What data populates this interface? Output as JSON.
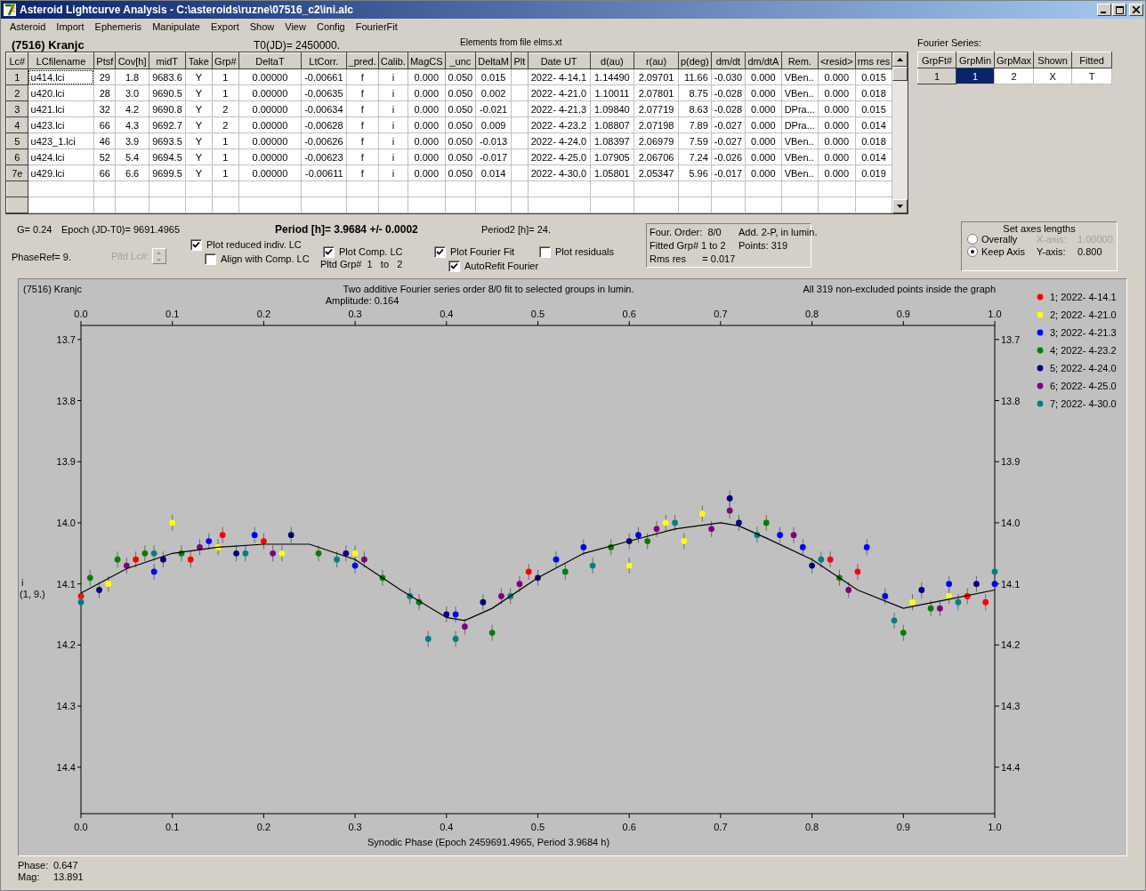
{
  "window": {
    "title": "Asteroid Lightcurve Analysis - C:\\asteroids\\ruzne\\07516_c2\\ini.alc"
  },
  "menu": [
    "Asteroid",
    "Import",
    "Ephemeris",
    "Manipulate",
    "Export",
    "Show",
    "View",
    "Config",
    "FourierFit"
  ],
  "header": {
    "object": "(7516) Kranjc",
    "t0": "T0(JD)= 2450000.",
    "elements_note": "Elements from file elms.xt"
  },
  "lc_table": {
    "columns": [
      "Lc#",
      "LCfilename",
      "Ptsf",
      "Cov[h]",
      "midT",
      "Take",
      "Grp#",
      "DeltaT",
      "LtCorr.",
      "_pred.",
      "Calib.",
      "MagCS",
      "_unc",
      "DeltaM",
      "Plt",
      "Date UT",
      "d(au)",
      "r(au)",
      "p(deg)",
      "dm/dt",
      "dm/dtA",
      "Rem.",
      "<resid>",
      "rms res"
    ],
    "rows": [
      {
        "focused": true,
        "cells": [
          "1",
          "u414.lci",
          "29",
          "1.8",
          "9683.6",
          "Y",
          "1",
          "0.00000",
          "-0.00661",
          "f",
          "i",
          "0.000",
          "0.050",
          "0.015",
          "",
          "2022- 4-14.1",
          "1.14490",
          "2.09701",
          "11.66",
          "-0.030",
          "0.000",
          "VBen..",
          "0.000",
          "0.015"
        ]
      },
      {
        "focused": false,
        "cells": [
          "2",
          "u420.lci",
          "28",
          "3.0",
          "9690.5",
          "Y",
          "1",
          "0.00000",
          "-0.00635",
          "f",
          "i",
          "0.000",
          "0.050",
          "0.002",
          "",
          "2022- 4-21.0",
          "1.10011",
          "2.07801",
          "8.75",
          "-0.028",
          "0.000",
          "VBen..",
          "0.000",
          "0.018"
        ]
      },
      {
        "focused": false,
        "cells": [
          "3",
          "u421.lci",
          "32",
          "4.2",
          "9690.8",
          "Y",
          "2",
          "0.00000",
          "-0.00634",
          "f",
          "i",
          "0.000",
          "0.050",
          "-0.021",
          "",
          "2022- 4-21.3",
          "1.09840",
          "2.07719",
          "8.63",
          "-0.028",
          "0.000",
          "DPra...",
          "0.000",
          "0.015"
        ]
      },
      {
        "focused": false,
        "cells": [
          "4",
          "u423.lci",
          "66",
          "4.3",
          "9692.7",
          "Y",
          "2",
          "0.00000",
          "-0.00628",
          "f",
          "i",
          "0.000",
          "0.050",
          "0.009",
          "",
          "2022- 4-23.2",
          "1.08807",
          "2.07198",
          "7.89",
          "-0.027",
          "0.000",
          "DPra...",
          "0.000",
          "0.014"
        ]
      },
      {
        "focused": false,
        "cells": [
          "5",
          "u423_1.lci",
          "46",
          "3.9",
          "9693.5",
          "Y",
          "1",
          "0.00000",
          "-0.00626",
          "f",
          "i",
          "0.000",
          "0.050",
          "-0.013",
          "",
          "2022- 4-24.0",
          "1.08397",
          "2.06979",
          "7.59",
          "-0.027",
          "0.000",
          "VBen..",
          "0.000",
          "0.018"
        ]
      },
      {
        "focused": false,
        "cells": [
          "6",
          "u424.lci",
          "52",
          "5.4",
          "9694.5",
          "Y",
          "1",
          "0.00000",
          "-0.00623",
          "f",
          "i",
          "0.000",
          "0.050",
          "-0.017",
          "",
          "2022- 4-25.0",
          "1.07905",
          "2.06706",
          "7.24",
          "-0.026",
          "0.000",
          "VBen..",
          "0.000",
          "0.014"
        ]
      },
      {
        "focused": false,
        "cells": [
          "7e",
          "u429.lci",
          "66",
          "6.6",
          "9699.5",
          "Y",
          "1",
          "0.00000",
          "-0.00611",
          "f",
          "i",
          "0.000",
          "0.050",
          "0.014",
          "",
          "2022- 4-30.0",
          "1.05801",
          "2.05347",
          "5.96",
          "-0.017",
          "0.000",
          "VBen..",
          "0.000",
          "0.019"
        ]
      }
    ]
  },
  "fourier_series": {
    "label": "Fourier Series:",
    "columns": [
      "GrpFt#",
      "GrpMin",
      "GrpMax",
      "Shown",
      "Fitted"
    ],
    "rows": [
      {
        "cells": [
          {
            "text": "1",
            "selected": false
          },
          {
            "text": "1",
            "selected": true
          },
          {
            "text": "2",
            "selected": false
          },
          {
            "text": "X",
            "selected": false
          },
          {
            "text": "T",
            "selected": false
          }
        ]
      }
    ]
  },
  "info": {
    "g": "G= 0.24",
    "epoch": "Epoch (JD-T0)= 9691.4965",
    "period": "Period [h]= 3.9684 +/- 0.0002",
    "period2": "Period2 [h]= 24.",
    "phase_ref": "PhaseRef= 9."
  },
  "pltd_lc": {
    "label": "Pltd Lc#:",
    "disabled": true
  },
  "checkboxes": [
    {
      "label": "Plot reduced indiv. LC",
      "checked": true
    },
    {
      "label": "Align with Comp. LC",
      "checked": false
    },
    {
      "label": "Plot Comp. LC",
      "checked": true
    },
    {
      "label": "Plot Fourier Fit",
      "checked": true
    },
    {
      "label": "AutoRefit Fourier",
      "checked": true
    },
    {
      "label": "Plot residuals",
      "checked": false
    }
  ],
  "pltd_grp": {
    "label": "Pltd Grp#",
    "from": "1",
    "to_label": "to",
    "to": "2"
  },
  "fit_summary": [
    "Four. Order:  8/0",
    "Add. 2-P, in lumin.",
    "Fitted Grp# 1 to 2",
    "Points: 319",
    "Rms res      = 0.017"
  ],
  "axes_lengths": {
    "title": "Set axes lengths",
    "radios": [
      {
        "label": "Overally",
        "selected": false
      },
      {
        "label": "Keep Axis",
        "selected": true
      }
    ],
    "fields": [
      {
        "label": "X-axis:",
        "value": "1.00000",
        "disabled": true
      },
      {
        "label": "Y-axis:",
        "value": "0.800",
        "disabled": false
      }
    ]
  },
  "plot_panel": {
    "object": "(7516) Kranjc",
    "amplitude": "Amplitude: 0.164",
    "points_note": "All 319 non-excluded points inside the graph",
    "ylabel_sub": "(1, 9.)",
    "top_axis_labels": [
      "0.0",
      "0.1",
      "0.2",
      "0.3",
      "0.4",
      "0.5",
      "0.6",
      "0.7",
      "0.8",
      "0.9",
      "1.0"
    ],
    "right_axis_labels": [
      "13.7",
      "13.8",
      "13.9",
      "14.0",
      "14.1",
      "14.2",
      "14.3",
      "14.4"
    ],
    "chart_data": {
      "type": "scatter",
      "title": "Two additive Fourier series order 8/0 fit to selected groups in lumin.",
      "xlabel": "Synodic Phase (Epoch 2459691.4965, Period 3.9684 h)",
      "ylabel": "i",
      "xlim": [
        0,
        1
      ],
      "ylim": [
        14.476,
        13.677
      ],
      "legend": "right",
      "xticks": [
        {
          "value": 0,
          "label": "0.0"
        },
        {
          "value": 0.1,
          "label": "0.1"
        },
        {
          "value": 0.2,
          "label": "0.2"
        },
        {
          "value": 0.3,
          "label": "0.3"
        },
        {
          "value": 0.4,
          "label": "0.4"
        },
        {
          "value": 0.5,
          "label": "0.5"
        },
        {
          "value": 0.6,
          "label": "0.6"
        },
        {
          "value": 0.7,
          "label": "0.7"
        },
        {
          "value": 0.8,
          "label": "0.8"
        },
        {
          "value": 0.9,
          "label": "0.9"
        },
        {
          "value": 1,
          "label": "1.0"
        }
      ],
      "yticks": [
        13.7,
        13.8,
        13.9,
        {
          "value": 14,
          "label": "14.0"
        },
        14.1,
        14.2,
        14.3,
        14.4
      ],
      "series": [
        {
          "name": "1; 2022- 4-14.1",
          "color": "#ff0000",
          "x": [
            0.0,
            0.06,
            0.12,
            0.155,
            0.2,
            0.49,
            0.82,
            0.85,
            0.97,
            0.99
          ],
          "values": [
            14.12,
            14.06,
            14.06,
            14.02,
            14.03,
            14.08,
            14.06,
            14.08,
            14.12,
            14.13
          ]
        },
        {
          "name": "2; 2022- 4-21.0",
          "color": "#ffff00",
          "x": [
            0.03,
            0.1,
            0.15,
            0.22,
            0.3,
            0.6,
            0.64,
            0.66,
            0.68,
            0.91,
            0.95
          ],
          "values": [
            14.1,
            14.0,
            14.04,
            14.05,
            14.05,
            14.07,
            14.0,
            14.03,
            13.985,
            14.13,
            14.12
          ]
        },
        {
          "name": "3; 2022- 4-21.3",
          "color": "#0000ff",
          "x": [
            0.08,
            0.14,
            0.19,
            0.3,
            0.41,
            0.52,
            0.55,
            0.61,
            0.765,
            0.79,
            0.86,
            0.88,
            0.95,
            1.0
          ],
          "values": [
            14.08,
            14.03,
            14.02,
            14.07,
            14.15,
            14.06,
            14.04,
            14.02,
            14.02,
            14.04,
            14.04,
            14.12,
            14.1,
            14.1
          ]
        },
        {
          "name": "4; 2022- 4-23.2",
          "color": "#008000",
          "x": [
            0.01,
            0.04,
            0.07,
            0.11,
            0.26,
            0.33,
            0.37,
            0.45,
            0.53,
            0.58,
            0.62,
            0.75,
            0.83,
            0.9,
            0.93
          ],
          "values": [
            14.09,
            14.06,
            14.05,
            14.05,
            14.05,
            14.09,
            14.13,
            14.18,
            14.08,
            14.04,
            14.03,
            14.0,
            14.09,
            14.18,
            14.14
          ]
        },
        {
          "name": "5; 2022- 4-24.0",
          "color": "#000080",
          "x": [
            0.02,
            0.09,
            0.17,
            0.23,
            0.29,
            0.4,
            0.44,
            0.5,
            0.6,
            0.71,
            0.72,
            0.8,
            0.92,
            0.98
          ],
          "values": [
            14.11,
            14.06,
            14.05,
            14.02,
            14.05,
            14.15,
            14.13,
            14.09,
            14.03,
            13.96,
            14.0,
            14.07,
            14.11,
            14.1
          ]
        },
        {
          "name": "6; 2022- 4-25.0",
          "color": "#800080",
          "x": [
            0.05,
            0.13,
            0.21,
            0.31,
            0.42,
            0.46,
            0.48,
            0.63,
            0.69,
            0.71,
            0.78,
            0.84,
            0.94
          ],
          "values": [
            14.07,
            14.04,
            14.05,
            14.06,
            14.17,
            14.12,
            14.1,
            14.01,
            14.01,
            13.98,
            14.02,
            14.11,
            14.14
          ]
        },
        {
          "name": "7; 2022- 4-30.0",
          "color": "#008080",
          "x": [
            0.0,
            0.08,
            0.18,
            0.28,
            0.36,
            0.38,
            0.41,
            0.47,
            0.56,
            0.65,
            0.74,
            0.81,
            0.89,
            0.96,
            1.0
          ],
          "values": [
            14.13,
            14.05,
            14.05,
            14.06,
            14.12,
            14.19,
            14.19,
            14.12,
            14.07,
            14.0,
            14.02,
            14.06,
            14.16,
            14.13,
            14.08
          ]
        },
        {
          "color": "#000000",
          "type": "line",
          "x": [
            0,
            0.05,
            0.1,
            0.15,
            0.2,
            0.25,
            0.3,
            0.35,
            0.4,
            0.42,
            0.45,
            0.5,
            0.55,
            0.6,
            0.65,
            0.7,
            0.72,
            0.75,
            0.8,
            0.85,
            0.9,
            0.95,
            1.0
          ],
          "values": [
            14.115,
            14.075,
            14.05,
            14.04,
            14.035,
            14.035,
            14.06,
            14.11,
            14.155,
            14.16,
            14.14,
            14.09,
            14.05,
            14.03,
            14.01,
            14.0,
            14.005,
            14.025,
            14.06,
            14.11,
            14.14,
            14.125,
            14.11
          ]
        }
      ]
    }
  },
  "status": [
    {
      "label": "Phase:",
      "value": "0.647"
    },
    {
      "label": "Mag:",
      "value": "13.891"
    }
  ]
}
